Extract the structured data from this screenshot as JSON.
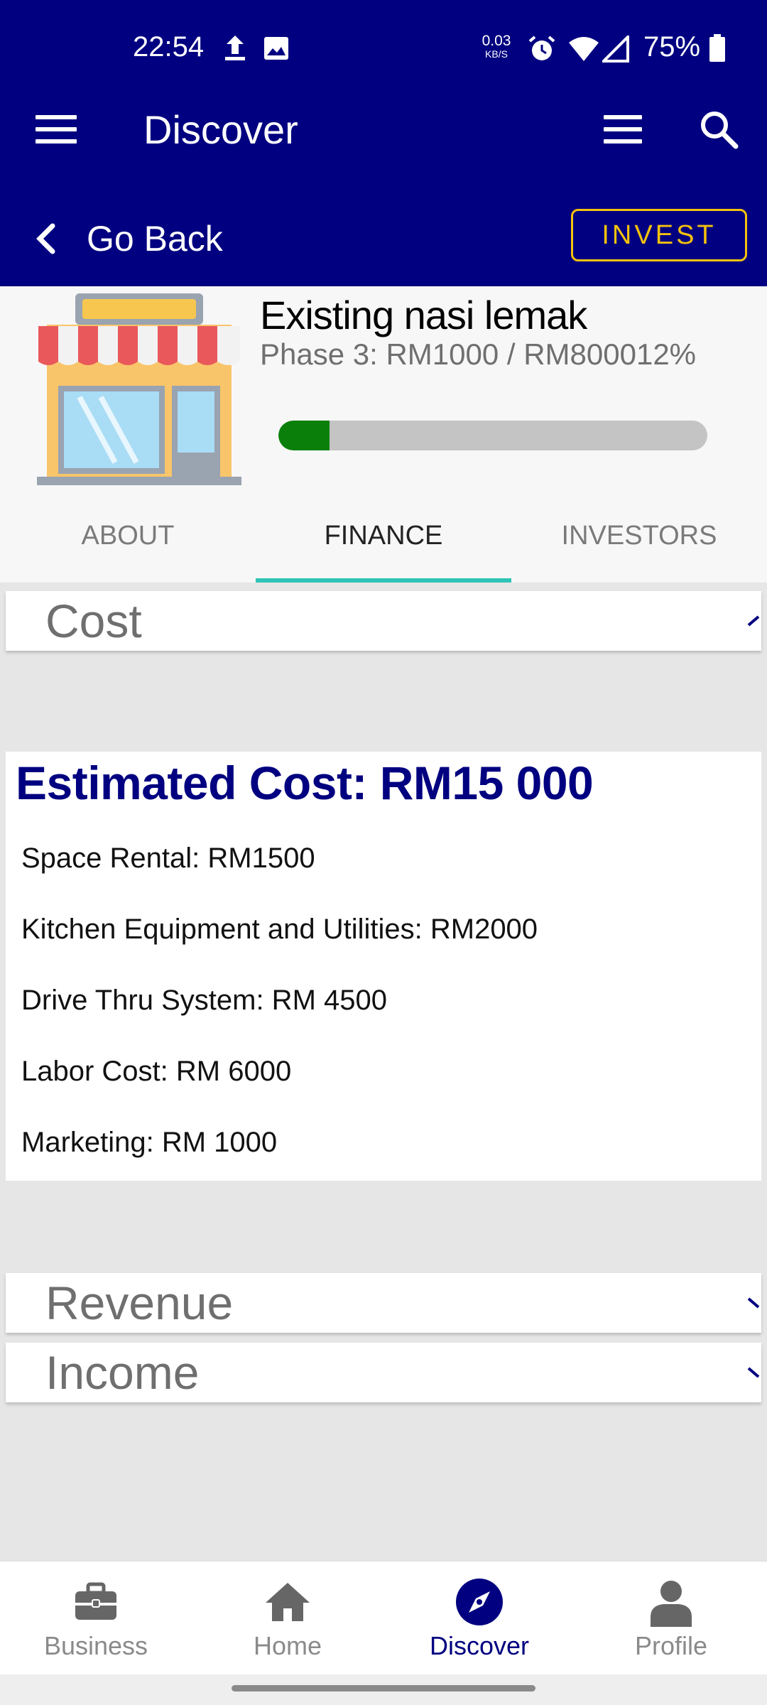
{
  "status_bar": {
    "time": "22:54",
    "net_speed_value": "0.03",
    "net_speed_unit": "KB/S",
    "battery": "75%"
  },
  "app_bar": {
    "title": "Discover"
  },
  "sub_bar": {
    "back_label": "Go Back",
    "invest_label": "INVEST"
  },
  "business": {
    "title": "Existing nasi lemak",
    "phase": "Phase 3: RM1000 / RM800012%",
    "progress_fraction": 0.12
  },
  "tabs": [
    {
      "label": "ABOUT",
      "active": false
    },
    {
      "label": "FINANCE",
      "active": true
    },
    {
      "label": "INVESTORS",
      "active": false
    }
  ],
  "sections": {
    "cost": {
      "title": "Cost",
      "expanded": true
    },
    "revenue": {
      "title": "Revenue",
      "expanded": false
    },
    "income": {
      "title": "Income",
      "expanded": false
    }
  },
  "cost_details": {
    "heading": "Estimated Cost: RM15 000",
    "items": [
      "Space Rental: RM1500",
      "Kitchen Equipment and Utilities: RM2000",
      "Drive Thru System: RM 4500",
      "Labor Cost: RM 6000",
      "Marketing: RM 1000"
    ]
  },
  "bottom_nav": [
    {
      "label": "Business",
      "icon": "briefcase-icon"
    },
    {
      "label": "Home",
      "icon": "home-icon"
    },
    {
      "label": "Discover",
      "icon": "compass-icon",
      "active": true
    },
    {
      "label": "Profile",
      "icon": "person-icon"
    }
  ],
  "colors": {
    "primary": "#000080",
    "accent": "#f4c20d",
    "tab_indicator": "#2ec4b6",
    "progress": "#0a800a"
  }
}
